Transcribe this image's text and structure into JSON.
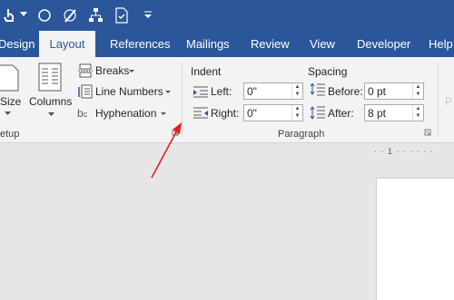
{
  "tabs": [
    {
      "label": "Design",
      "active": false
    },
    {
      "label": "Layout",
      "active": true
    },
    {
      "label": "References",
      "active": false
    },
    {
      "label": "Mailings",
      "active": false
    },
    {
      "label": "Review",
      "active": false
    },
    {
      "label": "View",
      "active": false
    },
    {
      "label": "Developer",
      "active": false
    },
    {
      "label": "Help",
      "active": false
    }
  ],
  "page_setup": {
    "size_label": "Size",
    "columns_label": "Columns",
    "breaks_label": "Breaks",
    "line_numbers_label": "Line Numbers",
    "hyphenation_label": "Hyphenation",
    "group_label": "etup"
  },
  "paragraph": {
    "indent_heading": "Indent",
    "spacing_heading": "Spacing",
    "left_label": "Left:",
    "right_label": "Right:",
    "left_value": "0\"",
    "right_value": "0\"",
    "before_label": "Before:",
    "after_label": "After:",
    "before_value": "0 pt",
    "after_value": "8 pt",
    "group_label": "Paragraph"
  },
  "ruler_text": "· · 1 · · · · · ·",
  "colors": {
    "accent": "#2b579a",
    "ribbon": "#f3f3f3",
    "annotation_arrow": "#e02020"
  }
}
